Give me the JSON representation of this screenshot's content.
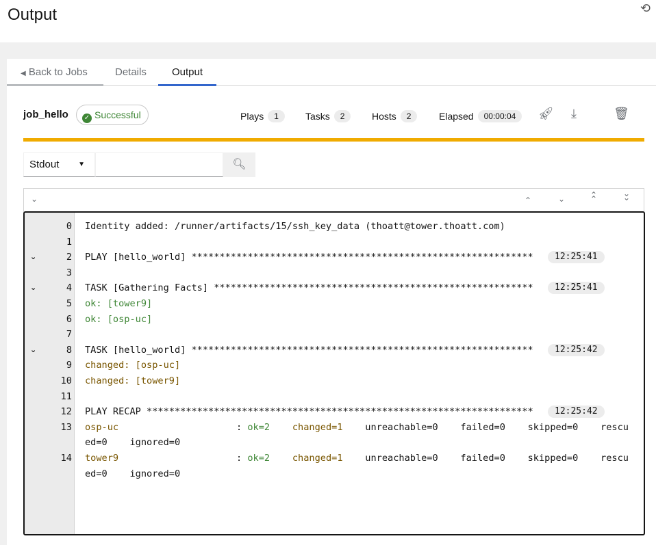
{
  "page": {
    "title": "Output"
  },
  "tabs": [
    {
      "label": "Back to Jobs"
    },
    {
      "label": "Details"
    },
    {
      "label": "Output"
    }
  ],
  "job": {
    "name": "job_hello",
    "status": "Successful",
    "stats": {
      "plays_label": "Plays",
      "plays": "1",
      "tasks_label": "Tasks",
      "tasks": "2",
      "hosts_label": "Hosts",
      "hosts": "2",
      "elapsed_label": "Elapsed",
      "elapsed": "00:00:04"
    }
  },
  "filter": {
    "selected": "Stdout",
    "search_placeholder": ""
  },
  "colors": {
    "accent": "#3366cc",
    "progress": "#f0ab00",
    "success": "#3e8635",
    "changed": "#795600"
  },
  "output": [
    {
      "n": "0",
      "text": "Identity added: /runner/artifacts/15/ssh_key_data (thoatt@tower.thoatt.com)"
    },
    {
      "n": "1",
      "text": ""
    },
    {
      "n": "2",
      "text": "PLAY [hello_world] *************************************************************",
      "time": "12:25:41",
      "toggle": true
    },
    {
      "n": "3",
      "text": ""
    },
    {
      "n": "4",
      "text": "TASK [Gathering Facts] *********************************************************",
      "time": "12:25:41",
      "toggle": true
    },
    {
      "n": "5",
      "text": "ok: [tower9]",
      "cls": "ok"
    },
    {
      "n": "6",
      "text": "ok: [osp-uc]",
      "cls": "ok"
    },
    {
      "n": "7",
      "text": ""
    },
    {
      "n": "8",
      "text": "TASK [hello_world] *************************************************************",
      "time": "12:25:42",
      "toggle": true
    },
    {
      "n": "9",
      "text": "changed: [osp-uc]",
      "cls": "ch"
    },
    {
      "n": "10",
      "text": "changed: [tower9]",
      "cls": "ch"
    },
    {
      "n": "11",
      "text": ""
    },
    {
      "n": "12",
      "text": "PLAY RECAP *********************************************************************",
      "time": "12:25:42"
    },
    {
      "n": "13",
      "host": "osp-uc",
      "recap": {
        "sep": "                     : ",
        "ok": "ok=2",
        "changed": "changed=1",
        "rest": "unreachable=0    failed=0    skipped=0    rescued=0    ignored=0"
      }
    },
    {
      "n": "14",
      "host": "tower9",
      "recap": {
        "sep": "                     : ",
        "ok": "ok=2",
        "changed": "changed=1",
        "rest": "unreachable=0    failed=0    skipped=0    rescued=0    ignored=0"
      }
    }
  ]
}
